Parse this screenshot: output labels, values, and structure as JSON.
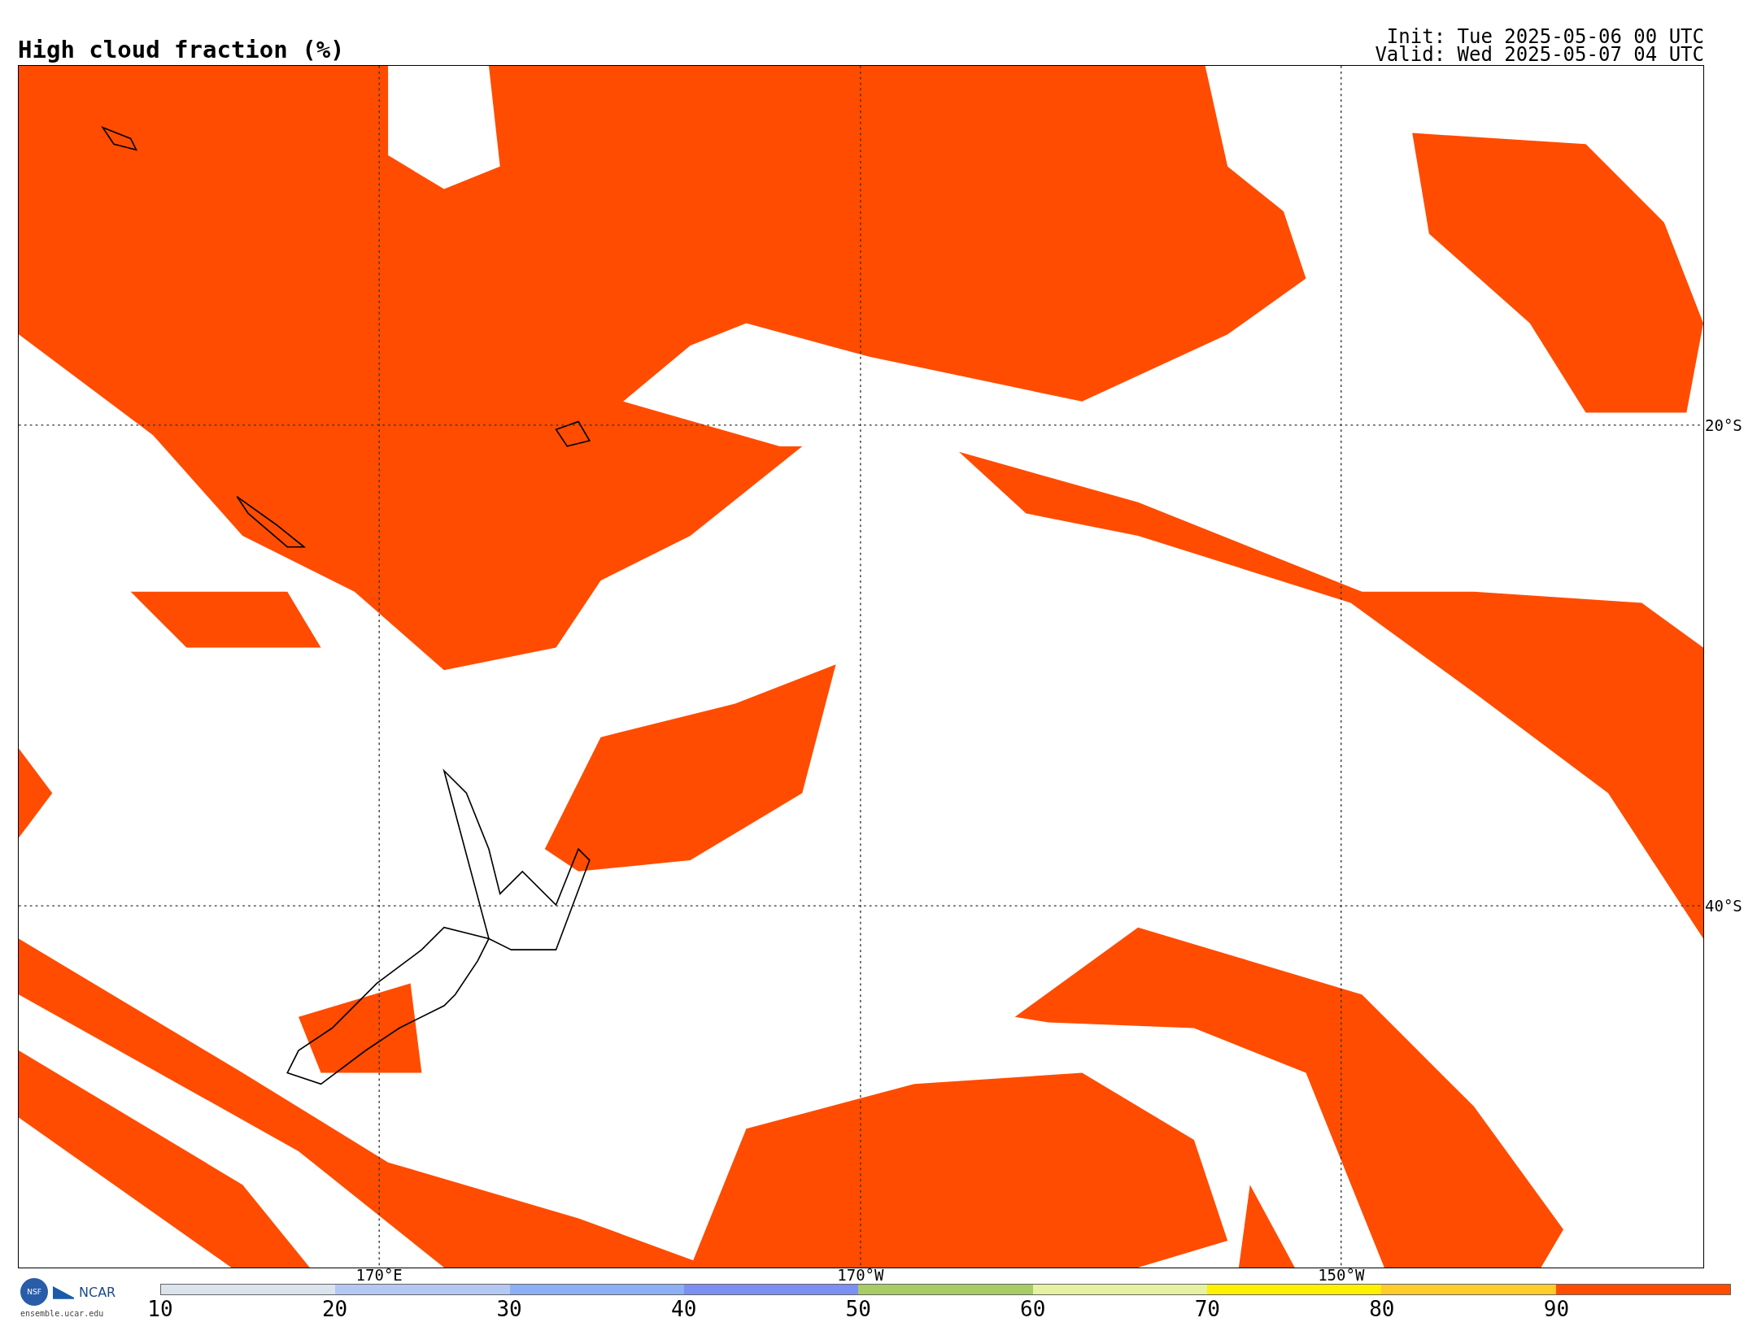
{
  "title": "High cloud fraction (%)",
  "init": "Init: Tue 2025-05-06 00 UTC",
  "valid": "Valid: Wed 2025-05-07 04 UTC",
  "map": {
    "lon_labels": [
      "170°E",
      "170°W",
      "150°W"
    ],
    "lat_labels": [
      "20°S",
      "40°S"
    ]
  },
  "logos": {
    "nsf": "NSF",
    "ncar": "NCAR",
    "url": "ensemble.ucar.edu"
  },
  "colorbar": {
    "segments": [
      {
        "color": "#dbe3ec"
      },
      {
        "color": "#b4c8f4"
      },
      {
        "color": "#8cb0f6"
      },
      {
        "color": "#7b90f2"
      },
      {
        "color": "#a8cc64"
      },
      {
        "color": "#e6f2a2"
      },
      {
        "color": "#fff000"
      },
      {
        "color": "#ffcc2a"
      },
      {
        "color": "#ff4c00"
      }
    ],
    "tick_labels": [
      "10",
      "20",
      "30",
      "40",
      "50",
      "60",
      "70",
      "80",
      "90"
    ]
  }
}
